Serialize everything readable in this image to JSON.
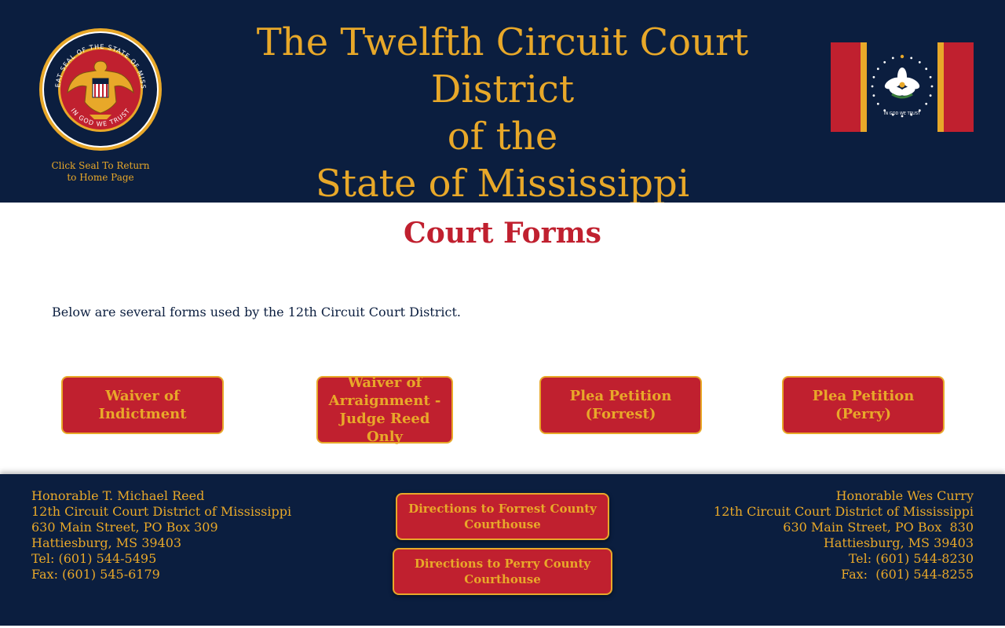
{
  "header": {
    "seal_caption_line1": "Click Seal To Return",
    "seal_caption_line2": "to Home Page",
    "seal_text_top": "THE GREAT SEAL OF THE STATE OF MISSISSIPPI",
    "seal_text_bottom": "IN GOD WE TRUST",
    "title_line1": "The Twelfth Circuit Court District",
    "title_line2": "of the",
    "title_line3": "State of Mississippi",
    "flag_text": "IN GOD WE TRUST"
  },
  "main": {
    "page_title": "Court Forms",
    "intro": "Below are several forms used by the 12th Circuit Court District.",
    "forms": [
      {
        "label": "Waiver of Indictment"
      },
      {
        "label": "Waiver of Arraignment - Judge Reed Only"
      },
      {
        "label": "Plea Petition (Forrest)"
      },
      {
        "label": "Plea Petition (Perry)"
      }
    ]
  },
  "footer": {
    "left": {
      "name": "Honorable T. Michael Reed",
      "org": "12th Circuit Court District of Mississippi",
      "address": "630 Main Street, PO Box 309",
      "city": "Hattiesburg, MS 39403",
      "tel": "Tel: (601) 544-5495",
      "fax": "Fax: (601) 545-6179"
    },
    "right": {
      "name": "Honorable Wes Curry",
      "org": "12th Circuit Court District of Mississippi",
      "address": "630 Main Street, PO Box  830",
      "city": "Hattiesburg, MS 39403",
      "tel": "Tel: (601) 544-8230",
      "fax": "Fax:  (601) 544-8255"
    },
    "directions": [
      {
        "label": "Directions to Forrest County Courthouse"
      },
      {
        "label": "Directions to Perry County Courthouse"
      }
    ]
  },
  "colors": {
    "navy": "#0b1e3f",
    "gold": "#e8a829",
    "red": "#c0202f",
    "white": "#ffffff"
  },
  "icons": {
    "seal": "state-seal-icon",
    "flag": "mississippi-flag-icon"
  }
}
